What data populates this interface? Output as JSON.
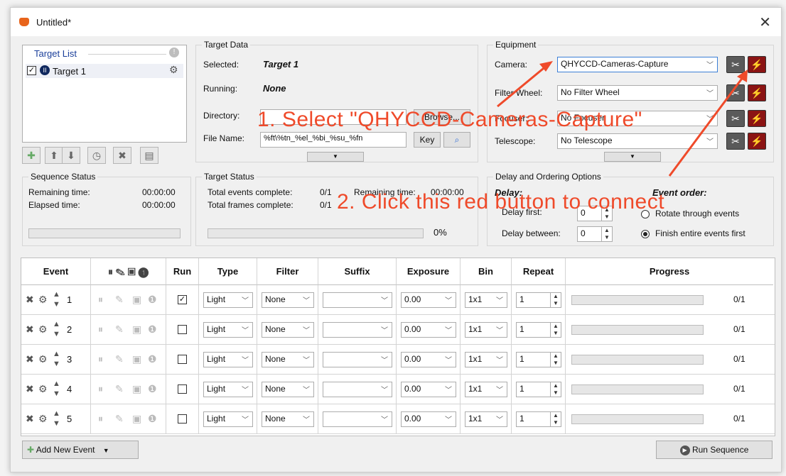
{
  "window": {
    "title": "Untitled*"
  },
  "target_list": {
    "header": "Target List",
    "items": [
      {
        "label": "Target 1",
        "checked": true
      }
    ]
  },
  "target_data": {
    "title": "Target Data",
    "selected_label": "Selected:",
    "selected_value": "Target 1",
    "running_label": "Running:",
    "running_value": "None",
    "directory_label": "Directory:",
    "browse_label": "Browse...",
    "filename_label": "File Name:",
    "filename_value": "%ft\\%tn_%el_%bi_%su_%fn",
    "key_label": "Key"
  },
  "equipment": {
    "title": "Equipment",
    "camera_label": "Camera:",
    "camera_value": "QHYCCD-Cameras-Capture",
    "filter_label": "Filter Wheel:",
    "filter_value": "No Filter Wheel",
    "focuser_label": "Focuser:",
    "focuser_value": "No Focuser",
    "telescope_label": "Telescope:",
    "telescope_value": "No Telescope"
  },
  "sequence_status": {
    "title": "Sequence Status",
    "remaining_label": "Remaining time:",
    "remaining_value": "00:00:00",
    "elapsed_label": "Elapsed time:",
    "elapsed_value": "00:00:00"
  },
  "target_status": {
    "title": "Target Status",
    "events_label": "Total events complete:",
    "events_value": "0/1",
    "remaining_label": "Remaining time:",
    "remaining_value": "00:00:00",
    "frames_label": "Total frames complete:",
    "frames_value": "0/1",
    "percent": "0%"
  },
  "delay": {
    "title": "Delay and Ordering Options",
    "delay_header": "Delay:",
    "delay_first_label": "Delay first:",
    "delay_first_value": "0",
    "delay_between_label": "Delay between:",
    "delay_between_value": "0",
    "order_header": "Event order:",
    "rotate_label": "Rotate through events",
    "finish_label": "Finish entire events first",
    "selected_order": "finish"
  },
  "grid": {
    "headers": {
      "event": "Event",
      "run": "Run",
      "type": "Type",
      "filter": "Filter",
      "suffix": "Suffix",
      "exposure": "Exposure",
      "bin": "Bin",
      "repeat": "Repeat",
      "progress": "Progress"
    },
    "rows": [
      {
        "num": "1",
        "run": true,
        "type": "Light",
        "filter": "None",
        "suffix": "",
        "exposure": "0.00",
        "bin": "1x1",
        "repeat": "1",
        "progress": "0/1"
      },
      {
        "num": "2",
        "run": false,
        "type": "Light",
        "filter": "None",
        "suffix": "",
        "exposure": "0.00",
        "bin": "1x1",
        "repeat": "1",
        "progress": "0/1"
      },
      {
        "num": "3",
        "run": false,
        "type": "Light",
        "filter": "None",
        "suffix": "",
        "exposure": "0.00",
        "bin": "1x1",
        "repeat": "1",
        "progress": "0/1"
      },
      {
        "num": "4",
        "run": false,
        "type": "Light",
        "filter": "None",
        "suffix": "",
        "exposure": "0.00",
        "bin": "1x1",
        "repeat": "1",
        "progress": "0/1"
      },
      {
        "num": "5",
        "run": false,
        "type": "Light",
        "filter": "None",
        "suffix": "",
        "exposure": "0.00",
        "bin": "1x1",
        "repeat": "1",
        "progress": "0/1"
      }
    ]
  },
  "footer": {
    "add_event_label": "Add New Event",
    "run_sequence_label": "Run Sequence"
  },
  "annotations": {
    "step1": "1. Select \"QHYCCD-Cameras-Capture\"",
    "step2": "2. Click this red button to connect",
    "color": "#ef4a2a"
  }
}
